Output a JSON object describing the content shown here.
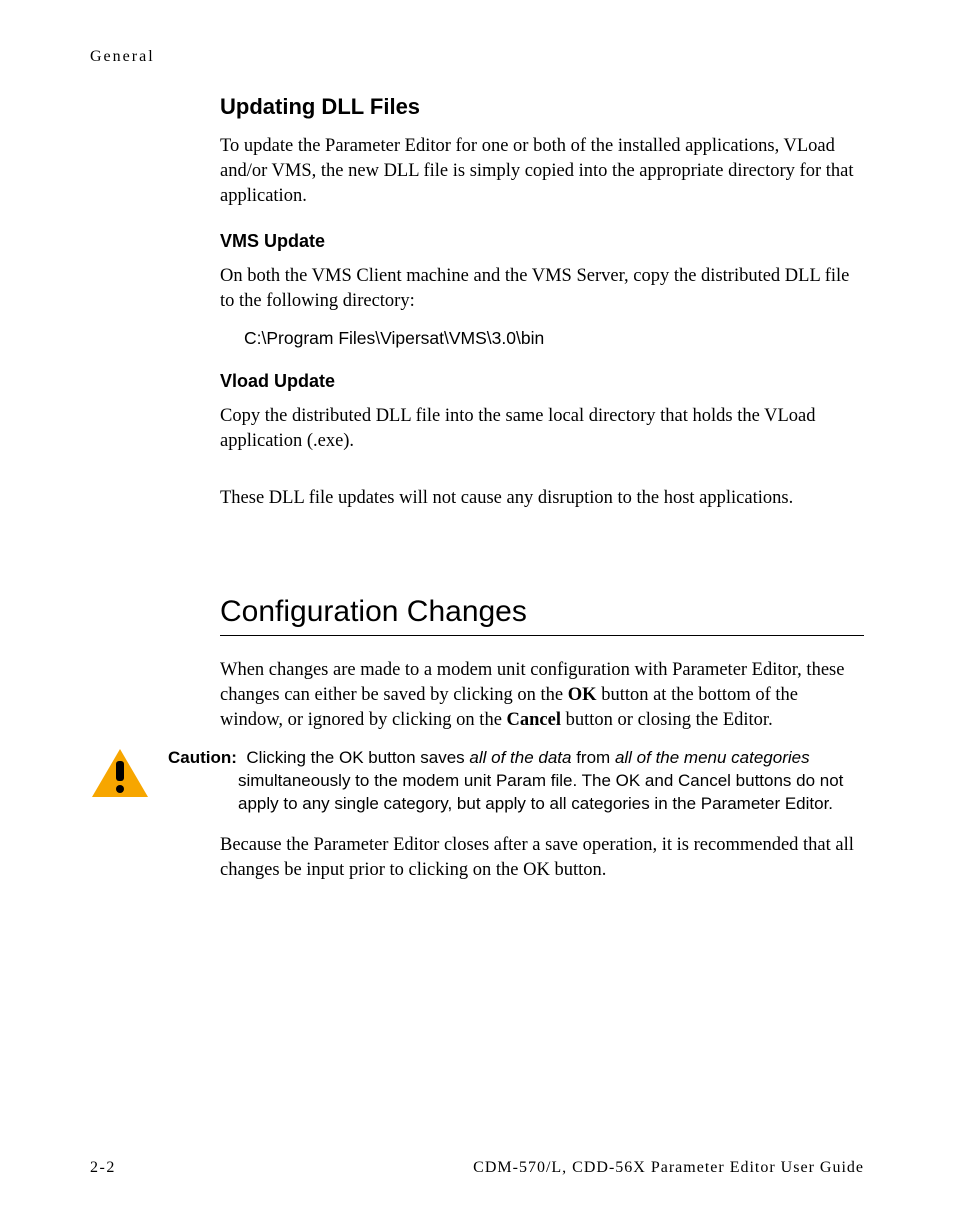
{
  "running_header": "General",
  "section1": {
    "title": "Updating DLL Files",
    "intro": "To update the Parameter Editor for one or both of the installed applications, VLoad and/or VMS, the new DLL file is simply copied into the appropriate directory for that application.",
    "vms": {
      "title": "VMS Update",
      "body": "On both the VMS Client machine and the VMS Server, copy the distributed DLL file to the following directory:",
      "path": "C:\\Program Files\\Vipersat\\VMS\\3.0\\bin"
    },
    "vload": {
      "title": "Vload Update",
      "body": "Copy the distributed DLL file into the same local directory that holds the VLoad application (.exe)."
    },
    "closing": "These DLL file updates will not cause any disruption to the host applications."
  },
  "section2": {
    "title": "Configuration Changes",
    "para1_a": "When changes are made to a modem unit configuration with Parameter Editor, these changes can either be saved by clicking on the ",
    "para1_ok": "OK",
    "para1_b": " button at the bottom of the window, or ignored by clicking on the ",
    "para1_cancel": "Cancel",
    "para1_c": " button or closing the Editor.",
    "caution": {
      "label": "Caution:",
      "part1": "Clicking the OK button saves ",
      "em1": "all of the data",
      "part2": " from ",
      "em2": "all of the menu categories",
      "part3": " simultaneously to the modem unit Param file. The OK and Cancel buttons do not apply to any single category, but apply to all categories in the Parameter Editor."
    },
    "para2": "Because the Parameter Editor closes after a save operation, it is recommended that all changes be input prior to clicking on the OK button."
  },
  "footer": {
    "left": "2-2",
    "right": "CDM-570/L, CDD-56X Parameter Editor User Guide"
  },
  "icons": {
    "caution": "caution-triangle"
  }
}
